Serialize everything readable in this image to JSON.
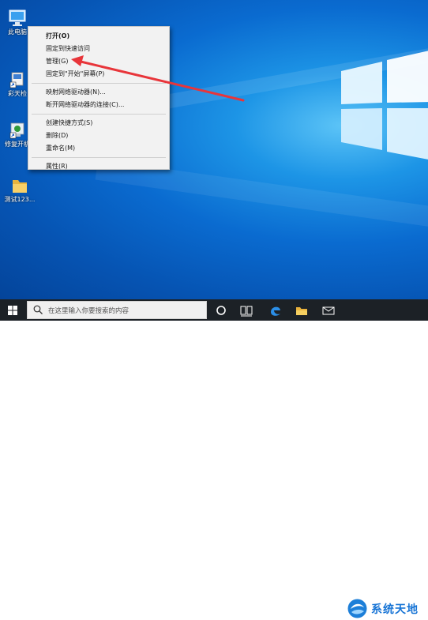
{
  "desktop": {
    "icons": [
      {
        "label": "此电脑"
      },
      {
        "label": "彩天检"
      },
      {
        "label": "修复开机"
      },
      {
        "label": "测试123..."
      }
    ]
  },
  "context_menu": {
    "items": [
      {
        "label": "打开(O)"
      },
      {
        "label": "固定到快速访问"
      },
      {
        "label": "管理(G)"
      },
      {
        "label": "固定到\"开始\"屏幕(P)"
      },
      {
        "label": "映射网络驱动器(N)..."
      },
      {
        "label": "断开网络驱动器的连接(C)..."
      },
      {
        "label": "创建快捷方式(S)"
      },
      {
        "label": "删除(D)"
      },
      {
        "label": "重命名(M)"
      },
      {
        "label": "属性(R)"
      }
    ]
  },
  "annotation": {
    "arrow_color": "#e8353a"
  },
  "taskbar": {
    "search_placeholder": "在这里输入你要搜索的内容"
  },
  "watermark": {
    "text": "系统天地"
  },
  "colors": {
    "taskbar": "#1c2126",
    "desktop_accent": "#1d95e6"
  }
}
